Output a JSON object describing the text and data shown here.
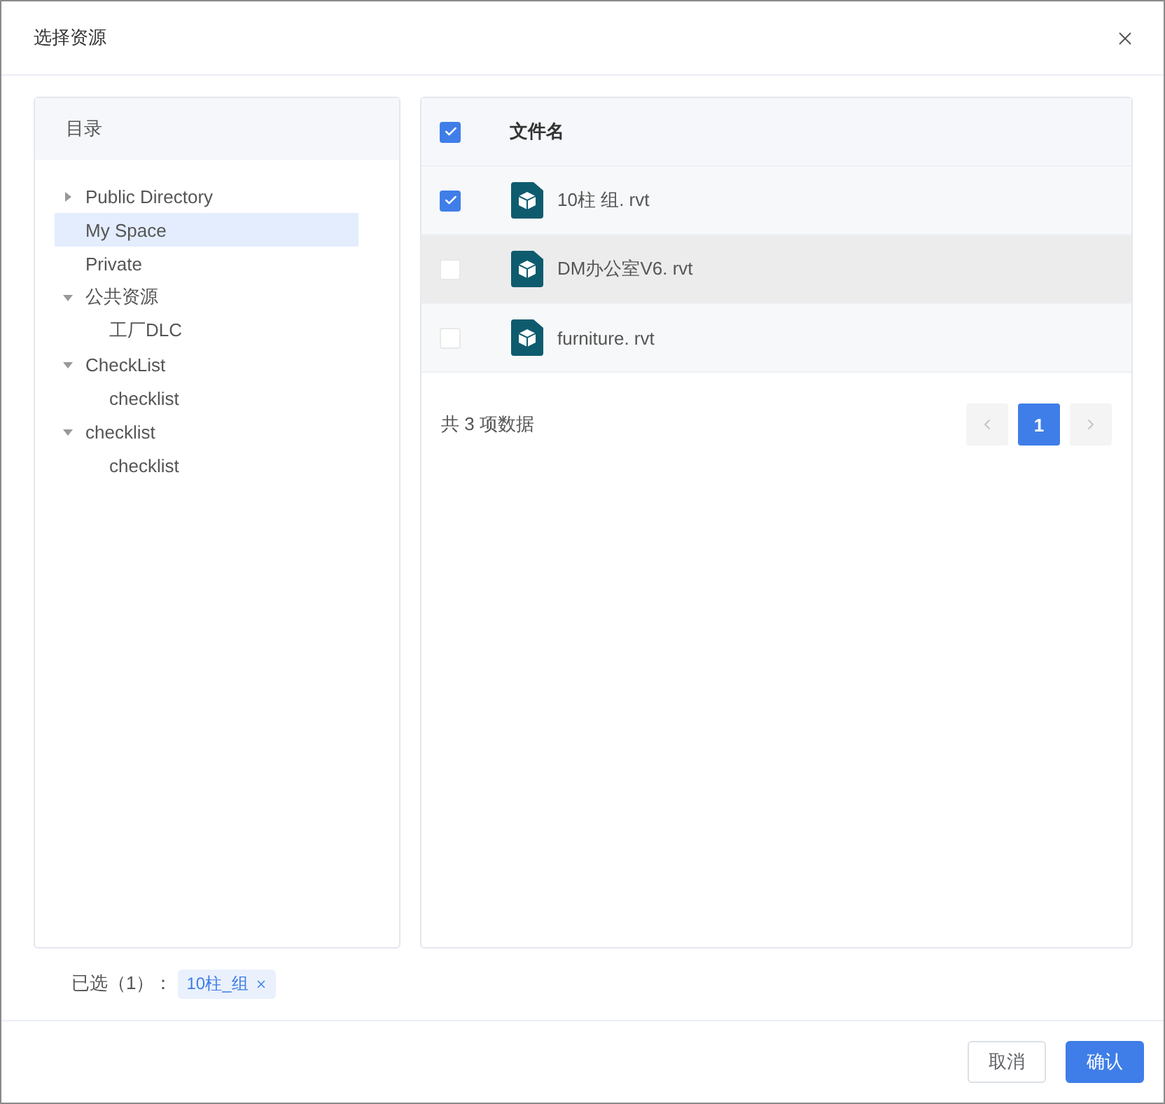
{
  "dialog": {
    "title": "选择资源"
  },
  "tree": {
    "title": "目录",
    "items": [
      {
        "label": "Public Directory",
        "expandable": true,
        "expanded": false,
        "selected": false
      },
      {
        "label": "My Space",
        "selected": true
      },
      {
        "label": "Private",
        "selected": false
      },
      {
        "label": "公共资源",
        "expanded": true,
        "selected": false,
        "children": [
          {
            "label": "工厂DLC",
            "selected": false
          }
        ]
      },
      {
        "label": "CheckList",
        "expanded": true,
        "selected": false,
        "children": [
          {
            "label": "checklist",
            "selected": false
          }
        ]
      },
      {
        "label": "checklist",
        "expanded": true,
        "selected": false,
        "children": [
          {
            "label": "checklist",
            "selected": false
          }
        ]
      }
    ]
  },
  "table": {
    "header_checked": true,
    "columns": [
      "文件名"
    ],
    "rows": [
      {
        "name": "10柱  组. rvt",
        "checked": true,
        "highlighted": false
      },
      {
        "name": "DM办公室V6. rvt",
        "checked": false,
        "highlighted": true
      },
      {
        "name": "furniture. rvt",
        "checked": false,
        "highlighted": false
      }
    ]
  },
  "pagination": {
    "total": "共 3 项数据",
    "pages": [
      {
        "label": "1",
        "selected": true
      }
    ]
  },
  "selection": {
    "label": "已选（1）：",
    "tags": [
      "10柱_组"
    ]
  },
  "buttons": [
    {
      "label": "取消",
      "kind": "default"
    },
    {
      "label": "确认",
      "kind": "primary"
    }
  ]
}
